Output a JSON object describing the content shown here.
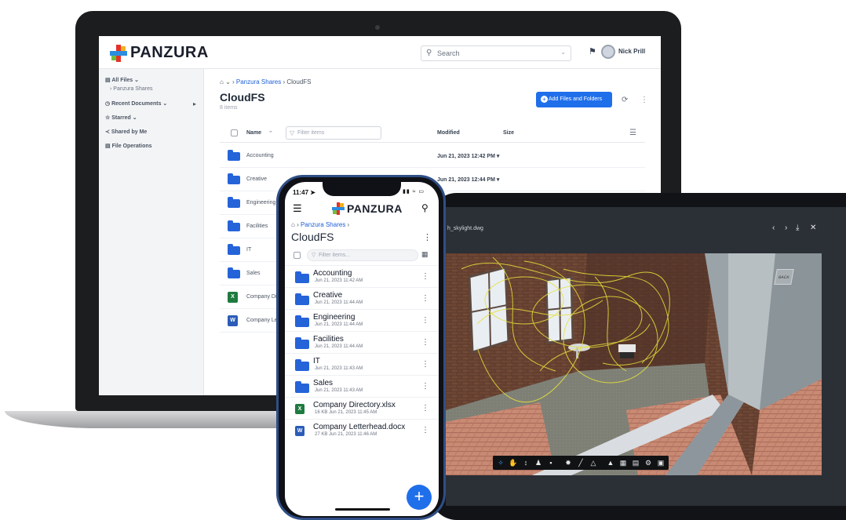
{
  "brand": {
    "name": "PANZURA",
    "mark_colors": [
      "#e4322b",
      "#f2b01e",
      "#2a8de0",
      "#6cbf43"
    ]
  },
  "web": {
    "search_placeholder": "Search",
    "user_label": "Nick Prill",
    "sidebar": {
      "items": [
        {
          "label": "All Files"
        },
        {
          "label": "Panzura Shares"
        },
        {
          "label": "Recent Documents"
        },
        {
          "label": "Starred"
        },
        {
          "label": "Shared by Me"
        },
        {
          "label": "File Operations"
        }
      ]
    },
    "breadcrumb": {
      "share": "Panzura Shares",
      "folder": "CloudFS"
    },
    "title": "CloudFS",
    "item_count": "8 items",
    "add_button": "Add Files and Folders",
    "columns": {
      "name": "Name",
      "filter_placeholder": "Filter items",
      "modified": "Modified",
      "size": "Size"
    },
    "rows": [
      {
        "name": "Accounting",
        "modified": "Jun 21, 2023 12:42 PM"
      },
      {
        "name": "Creative",
        "modified": "Jun 21, 2023 12:44 PM"
      },
      {
        "name": "Engineering",
        "modified": ""
      },
      {
        "name": "Facilities",
        "modified": ""
      },
      {
        "name": "IT",
        "modified": ""
      },
      {
        "name": "Sales",
        "modified": ""
      },
      {
        "name": "Company Directory.xlsx",
        "modified": "",
        "type": "xlsx"
      },
      {
        "name": "Company Letterhead.docx",
        "modified": "",
        "type": "docx"
      }
    ]
  },
  "phone": {
    "time": "11:47",
    "breadcrumb": {
      "share": "Panzura Shares"
    },
    "title": "CloudFS",
    "filter_placeholder": "Filter items...",
    "items": [
      {
        "name": "Accounting",
        "meta": "Jun 21, 2023 11:42 AM",
        "kind": "folder"
      },
      {
        "name": "Creative",
        "meta": "Jun 21, 2023 11:44 AM",
        "kind": "folder"
      },
      {
        "name": "Engineering",
        "meta": "Jun 21, 2023 11:44 AM",
        "kind": "folder"
      },
      {
        "name": "Facilities",
        "meta": "Jun 21, 2023 11:44 AM",
        "kind": "folder"
      },
      {
        "name": "IT",
        "meta": "Jun 21, 2023 11:43 AM",
        "kind": "folder"
      },
      {
        "name": "Sales",
        "meta": "Jun 21, 2023 11:43 AM",
        "kind": "folder"
      },
      {
        "name": "Company Directory.xlsx",
        "meta": "16 KB Jun 21, 2023 11:45 AM",
        "kind": "xlsx"
      },
      {
        "name": "Company Letterhead.docx",
        "meta": "27 KB Jun 21, 2023 11:46 AM",
        "kind": "docx"
      }
    ],
    "fab_label": "+"
  },
  "tablet": {
    "file_name": "h_skylight.dwg",
    "view_cube_label": "BACK"
  },
  "colors": {
    "accent": "#1f6feb",
    "folder": "#2563d9",
    "excel": "#1f7a3f",
    "word": "#2b5cb8"
  }
}
